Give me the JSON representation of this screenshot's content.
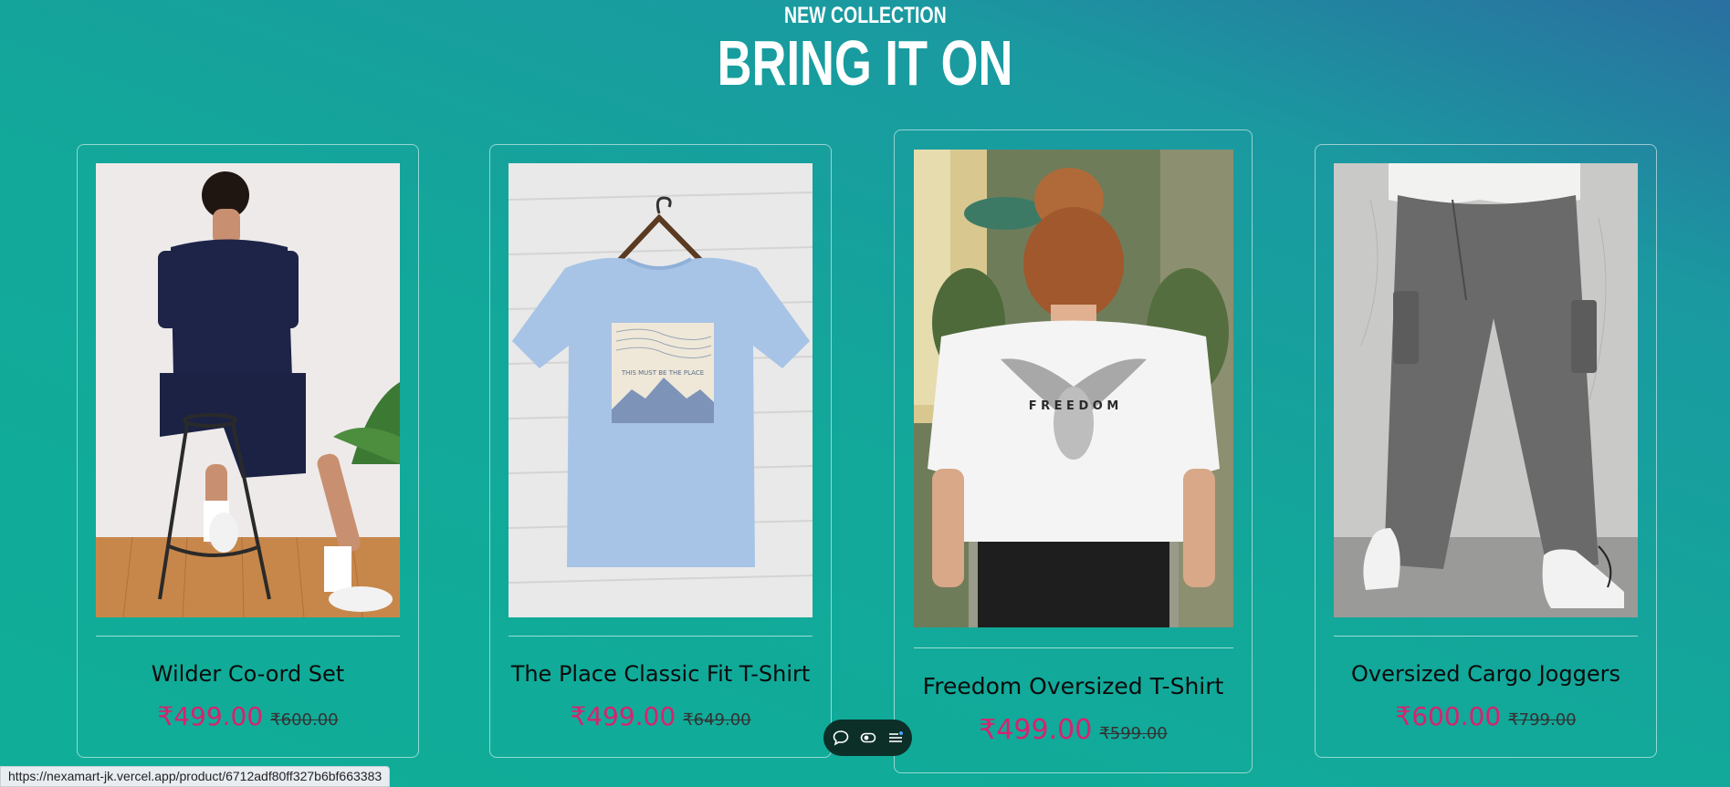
{
  "header": {
    "eyebrow": "NEW COLLECTION",
    "title": "BRING IT ON"
  },
  "products": [
    {
      "name": "Wilder Co-ord Set",
      "price": "₹499.00",
      "old_price": "₹600.00"
    },
    {
      "name": "The Place Classic Fit T-Shirt",
      "price": "₹499.00",
      "old_price": "₹649.00"
    },
    {
      "name": "Freedom Oversized T-Shirt",
      "price": "₹499.00",
      "old_price": "₹599.00"
    },
    {
      "name": "Oversized Cargo Joggers",
      "price": "₹600.00",
      "old_price": "₹799.00"
    }
  ],
  "artwork": {
    "tshirt_print_text": "THIS MUST BE THE PLACE",
    "freedom_print_text": "F R E E D O M"
  },
  "dock": {
    "icons": [
      "chat-icon",
      "toggle-icon",
      "menu-icon"
    ]
  },
  "status_bar": {
    "url": "https://nexamart-jk.vercel.app/product/6712adf80ff327b6bf663383"
  },
  "colors": {
    "accent_price": "#d8226e",
    "bg_start": "#2a6fa0",
    "bg_end": "#10ae98"
  }
}
